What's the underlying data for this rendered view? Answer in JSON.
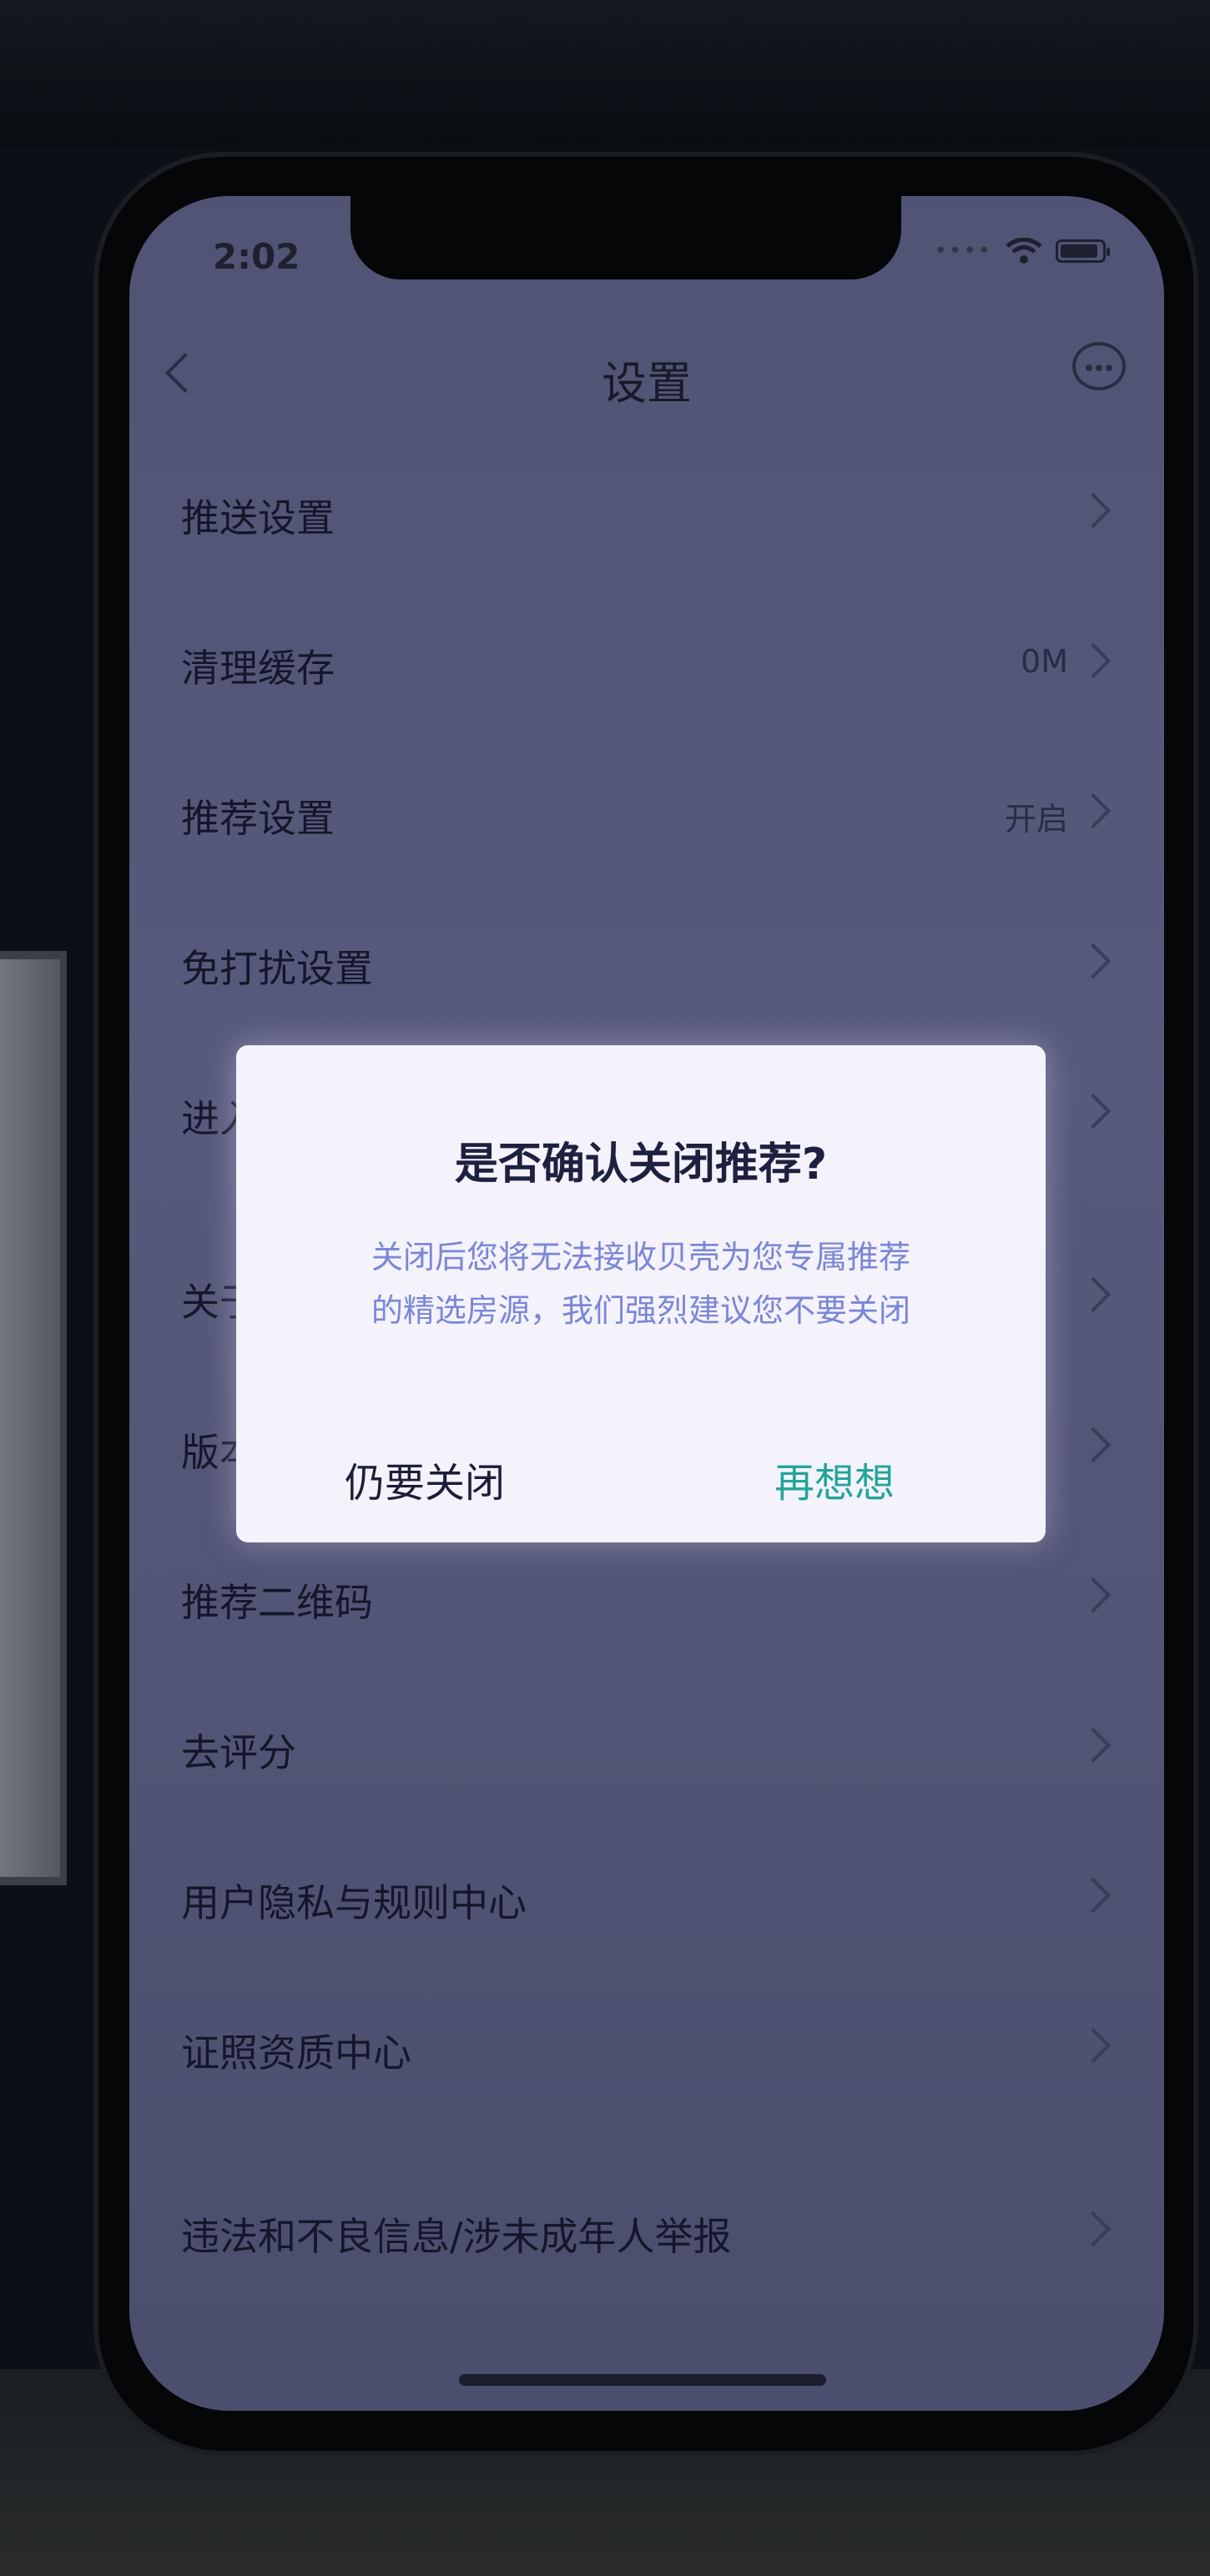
{
  "status_bar": {
    "time": "2:02"
  },
  "nav": {
    "title": "设置"
  },
  "settings": {
    "items": [
      {
        "label": "推送设置",
        "value": ""
      },
      {
        "label": "清理缓存",
        "value": "0M"
      },
      {
        "label": "推荐设置",
        "value": "开启"
      },
      {
        "label": "免打扰设置",
        "value": ""
      },
      {
        "label": "进入",
        "value": ""
      },
      {
        "label": "关于",
        "value": ""
      },
      {
        "label": "版本",
        "value": ""
      },
      {
        "label": "推荐二维码",
        "value": ""
      },
      {
        "label": "去评分",
        "value": ""
      },
      {
        "label": "用户隐私与规则中心",
        "value": ""
      },
      {
        "label": "证照资质中心",
        "value": ""
      },
      {
        "label": "违法和不良信息/涉未成年人举报",
        "value": ""
      }
    ]
  },
  "dialog": {
    "title": "是否确认关闭推荐?",
    "message_line1": "关闭后您将无法接收贝壳为您专属推荐",
    "message_line2": "的精选房源，我们强烈建议您不要关闭",
    "confirm_label": "仍要关闭",
    "cancel_label": "再想想"
  },
  "colors": {
    "accent": "#23a59a",
    "message": "#7a86d8"
  }
}
